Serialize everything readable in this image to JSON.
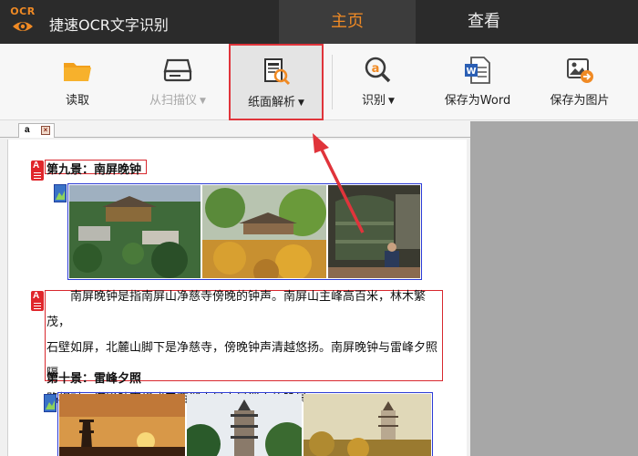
{
  "app": {
    "logo_text": "OCR",
    "title": "捷速OCR文字识别"
  },
  "nav": {
    "tabs": [
      {
        "label": "主页",
        "active": true
      },
      {
        "label": "查看",
        "active": false
      }
    ]
  },
  "toolbar": {
    "items": [
      {
        "label": "读取",
        "icon": "folder-icon",
        "enabled": true,
        "dropdown": false
      },
      {
        "label": "从扫描仪",
        "icon": "scanner-icon",
        "enabled": false,
        "dropdown": true
      },
      {
        "label": "纸面解析",
        "icon": "page-analysis-icon",
        "enabled": true,
        "dropdown": true,
        "highlighted": true
      },
      {
        "label": "识别",
        "icon": "recognize-icon",
        "enabled": true,
        "dropdown": true
      },
      {
        "label": "保存为Word",
        "icon": "word-doc-icon",
        "enabled": true,
        "dropdown": false
      },
      {
        "label": "保存为图片",
        "icon": "save-image-icon",
        "enabled": true,
        "dropdown": false
      }
    ],
    "dropdown_glyph": "▼"
  },
  "document": {
    "tab_label": "a",
    "tab_close_glyph": "×",
    "region_text_glyph": "A",
    "heading1": "第九景：南屏晚钟",
    "paragraph_lines": [
      "南屏晚钟是指南屏山净慈寺傍晚的钟声。南屏山主峰高百米，林木繁茂，",
      "石壁如屏，北麓山脚下是净慈寺，傍晚钟声清越悠扬。南屏晚钟与雷峰夕照隔",
      "路相对，塔影钟声组成了西湖十景中最迷人的晚景。"
    ],
    "heading2": "第十景：雷峰夕照"
  },
  "colors": {
    "accent": "#f08a24",
    "title_bar": "#2b2b2b",
    "highlight_box": "#e0343b",
    "text_region": "#d8282e",
    "image_region": "#2b3bd6"
  }
}
